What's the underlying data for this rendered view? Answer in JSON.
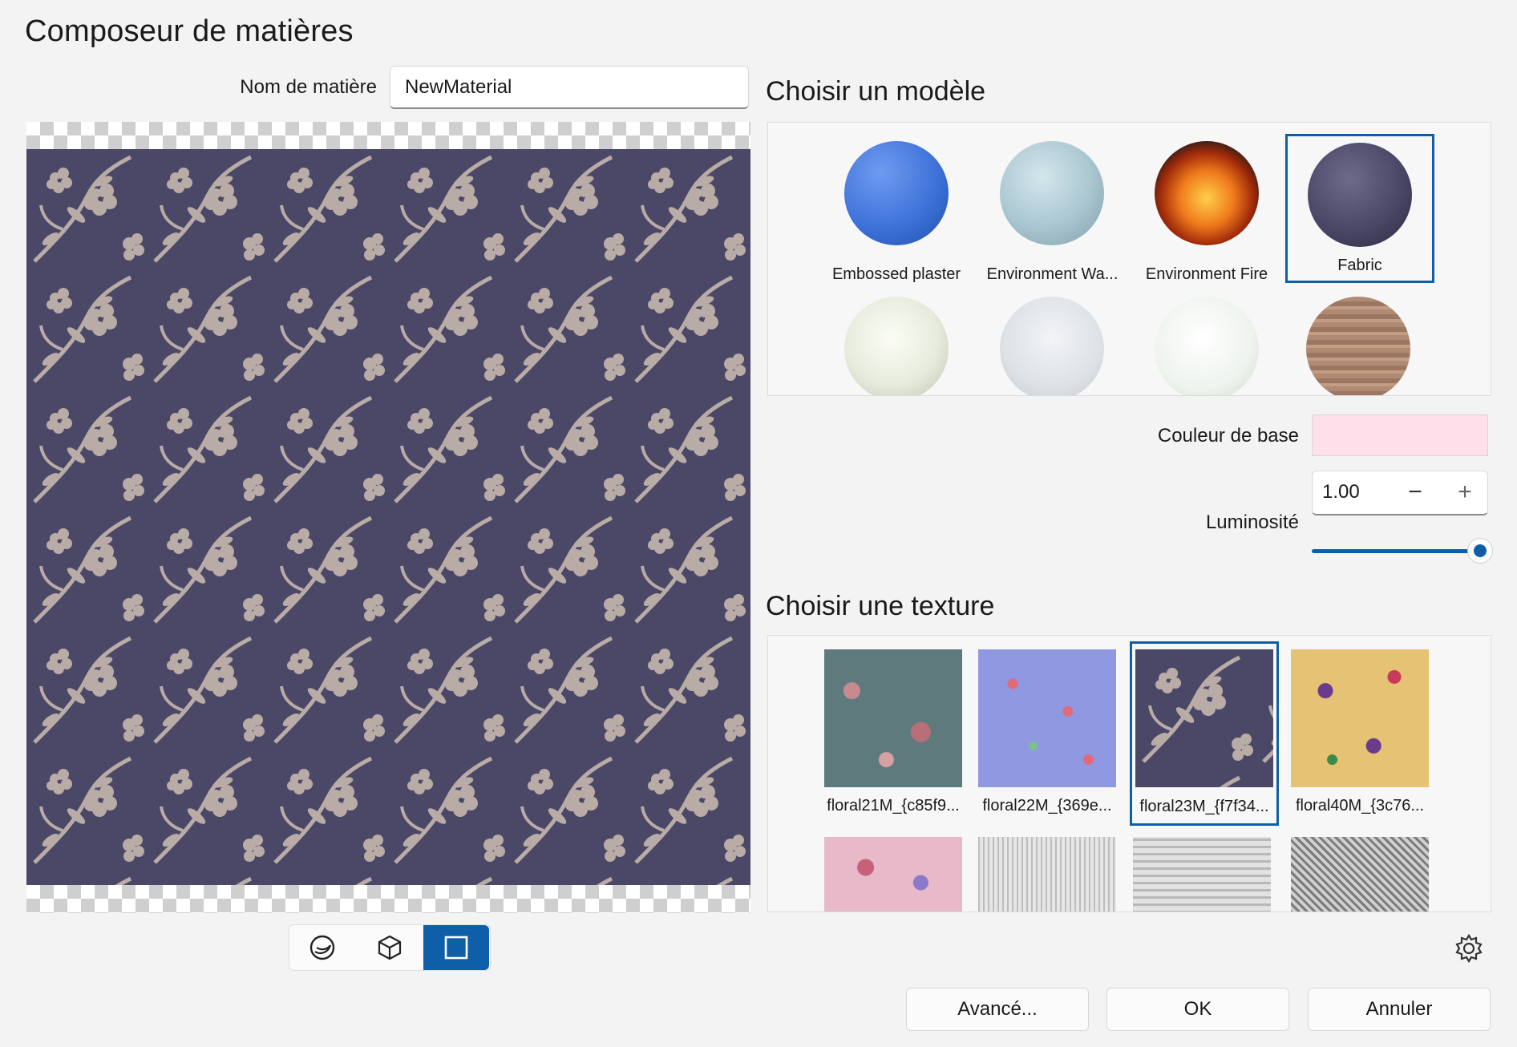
{
  "window": {
    "title": "Composeur de matières"
  },
  "material": {
    "name_label": "Nom de matière",
    "name_value": "NewMaterial"
  },
  "view_modes": [
    {
      "name": "sphere-view-icon",
      "active": false
    },
    {
      "name": "cube-view-icon",
      "active": false
    },
    {
      "name": "plane-view-icon",
      "active": true
    }
  ],
  "models": {
    "heading": "Choisir un modèle",
    "items": [
      {
        "label": "Embossed plaster",
        "color": "#3f73d9"
      },
      {
        "label": "Environment Wa...",
        "color": "#a9c6d0"
      },
      {
        "label": "Environment Fire",
        "color": "#e0701c"
      },
      {
        "label": "Fabric",
        "color": "#4b4867",
        "selected": true
      },
      {
        "label": "",
        "color": "#e7ebdd"
      },
      {
        "label": "",
        "color": "#dde2e6"
      },
      {
        "label": "",
        "color": "#eef3ee"
      },
      {
        "label": "",
        "color": "#9b7762"
      }
    ]
  },
  "properties": {
    "base_color_label": "Couleur de base",
    "base_color": "#ffe0ea",
    "brightness_label": "Luminosité",
    "brightness_value": "1.00",
    "brightness_level": 1.0
  },
  "textures": {
    "heading": "Choisir une texture",
    "items": [
      {
        "label": "floral21M_{c85f9...",
        "color": "#5f7a7c"
      },
      {
        "label": "floral22M_{369e...",
        "color": "#8f98e0"
      },
      {
        "label": "floral23M_{f7f34...",
        "color": "#4b4867",
        "selected": true
      },
      {
        "label": "floral40M_{3c76...",
        "color": "#e6c274"
      },
      {
        "label": "",
        "color": "#e8b9c9"
      },
      {
        "label": "",
        "color": "#d4d4d4"
      },
      {
        "label": "",
        "color": "#d0d0d0"
      },
      {
        "label": "",
        "color": "#a9a9a9"
      }
    ]
  },
  "buttons": {
    "advanced": "Avancé...",
    "ok": "OK",
    "cancel": "Annuler"
  },
  "colors": {
    "accent": "#0f5fa8",
    "fabric_base": "#4b4867",
    "fabric_pattern": "#b9aca7"
  }
}
